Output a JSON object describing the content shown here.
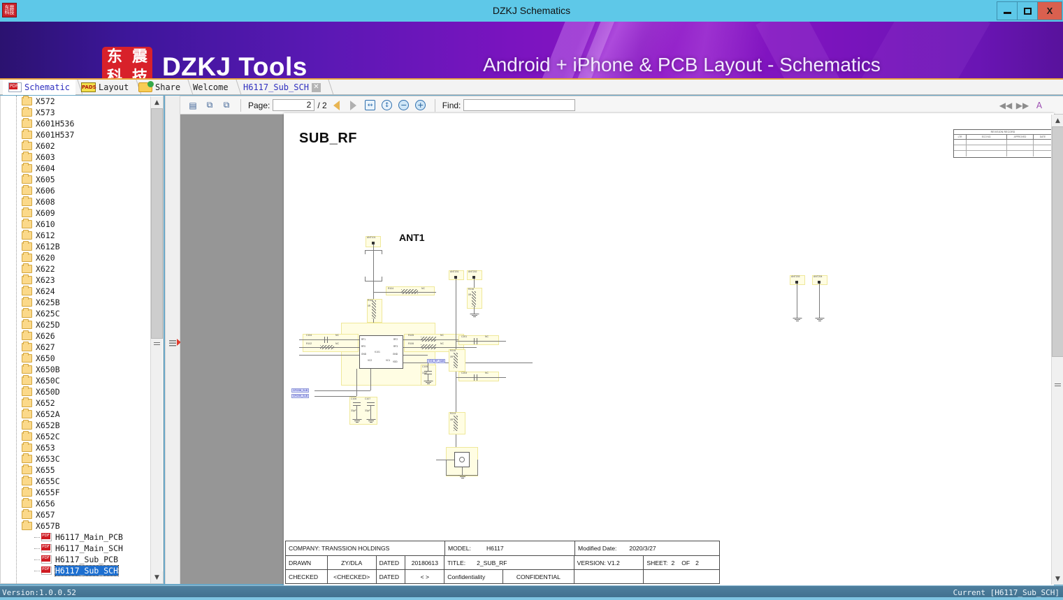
{
  "window": {
    "title": "DZKJ Schematics",
    "icon_name": "app-icon",
    "minimize": "–",
    "maximize": "□",
    "close": "X"
  },
  "banner": {
    "logo_chars": [
      "东",
      "震",
      "科",
      "技"
    ],
    "brand": "DZKJ Tools",
    "tagline": "Android + iPhone & PCB Layout - Schematics",
    "bg_color": "#7a14bf"
  },
  "tabs": [
    {
      "label": "Schematic",
      "icon": "pdf-icon",
      "active": true,
      "closable": false
    },
    {
      "label": "Layout",
      "icon": "pads-icon",
      "active": false,
      "closable": false
    },
    {
      "label": "Share",
      "icon": "folder-share-icon",
      "active": false,
      "closable": false
    },
    {
      "label": "Welcome",
      "icon": "",
      "active": false,
      "closable": false
    },
    {
      "label": "H6117_Sub_SCH",
      "icon": "",
      "active": true,
      "closable": true,
      "close_glyph": "✕"
    }
  ],
  "tree": {
    "folders": [
      "X572",
      "X573",
      "X601H536",
      "X601H537",
      "X602",
      "X603",
      "X604",
      "X605",
      "X606",
      "X608",
      "X609",
      "X610",
      "X612",
      "X612B",
      "X620",
      "X622",
      "X623",
      "X624",
      "X625B",
      "X625C",
      "X625D",
      "X626",
      "X627",
      "X650",
      "X650B",
      "X650C",
      "X650D",
      "X652",
      "X652A",
      "X652B",
      "X652C",
      "X653",
      "X653C",
      "X655",
      "X655C",
      "X655F",
      "X656",
      "X657"
    ],
    "expanded_folder": "X657B",
    "files": [
      {
        "label": "H6117_Main_PCB",
        "selected": false
      },
      {
        "label": "H6117_Main_SCH",
        "selected": false
      },
      {
        "label": "H6117_Sub_PCB",
        "selected": false
      },
      {
        "label": "H6117_Sub_SCH",
        "selected": true
      }
    ],
    "expand_glyph": "+",
    "collapse_glyph": "−"
  },
  "toolbar": {
    "copy_icon": "copy-icon",
    "snapshot_icon": "snapshot-icon",
    "clipboard_icon": "clipboard-icon",
    "page_label": "Page:",
    "page_value": "2",
    "page_total": "/ 2",
    "prev_icon": "prev-page-icon",
    "next_icon": "next-page-icon",
    "fit_width_icon": "fit-width-icon",
    "fit_page_icon": "fit-page-icon",
    "zoom_out_glyph": "−",
    "zoom_in_glyph": "+",
    "find_label": "Find:",
    "find_value": "",
    "find_placeholder": "",
    "find_prev_icon": "find-prev-icon",
    "find_next_icon": "find-next-icon",
    "font-icon": "text-style-icon"
  },
  "sheet": {
    "title": "SUB_RF",
    "block_title": "ANT1",
    "revision_table": {
      "caption": "REVISION RECORD",
      "headers": [
        "LTR",
        "ECO NO.",
        "APPROVED",
        "DATE"
      ],
      "rows": [
        [
          "",
          "",
          "",
          ""
        ],
        [
          "",
          "",
          "",
          ""
        ],
        [
          "",
          "",
          "",
          ""
        ]
      ]
    },
    "title_block": {
      "company_label": "COMPANY: TRANSSION HOLDINGS",
      "model_label": "MODEL:",
      "model_value": "H6117",
      "modified_label": "Modified Date:",
      "modified_value": "2020/3/27",
      "drawn_label": "DRAWN",
      "drawn_value": "ZY/DLA",
      "drawn_dated_label": "DATED",
      "drawn_dated_value": "20180613",
      "sch_title_label": "TITLE:",
      "sch_title_value": "2_SUB_RF",
      "version_label": "VERSION: V1.2",
      "sheet_label": "SHEET:",
      "sheet_num": "2",
      "sheet_of": "OF",
      "sheet_total": "2",
      "checked_label": "CHECKED",
      "checked_value": "<CHECKED>",
      "checked_dated_label": "DATED",
      "checked_dated_value": "<  >",
      "confidentiality_label": "Confidentiality",
      "confidentiality_value": "CONFIDENTIAL"
    },
    "components": {
      "antenna_pads": [
        "ANT101",
        "ANT201",
        "ANT202",
        "ANT203",
        "ANT204"
      ],
      "ic_ref": "K101",
      "ic_pins_left": [
        "RF1",
        "RF0",
        "GND"
      ],
      "ic_pins_right": [
        "RF2",
        "RF3",
        "GND",
        "VDD"
      ],
      "ic_pins_bottom": [
        "VC2",
        "VC1"
      ],
      "resistors": [
        "R104",
        "R107",
        "R102",
        "R105",
        "R106",
        "R216",
        "R215"
      ],
      "capacitors": [
        "C104",
        "C105",
        "C106",
        "C107",
        "C201",
        "C203",
        "C204",
        "C205"
      ],
      "values": [
        "NC",
        "0R",
        "10pF",
        "33pF",
        "1uF"
      ],
      "net_labels": [
        "GPIO98_SUB",
        "GPIO99_SUB",
        "VDD_RF_SUB"
      ]
    }
  },
  "status": {
    "version": "Version:1.0.0.52",
    "current": "Current [H6117_Sub_SCH]"
  }
}
